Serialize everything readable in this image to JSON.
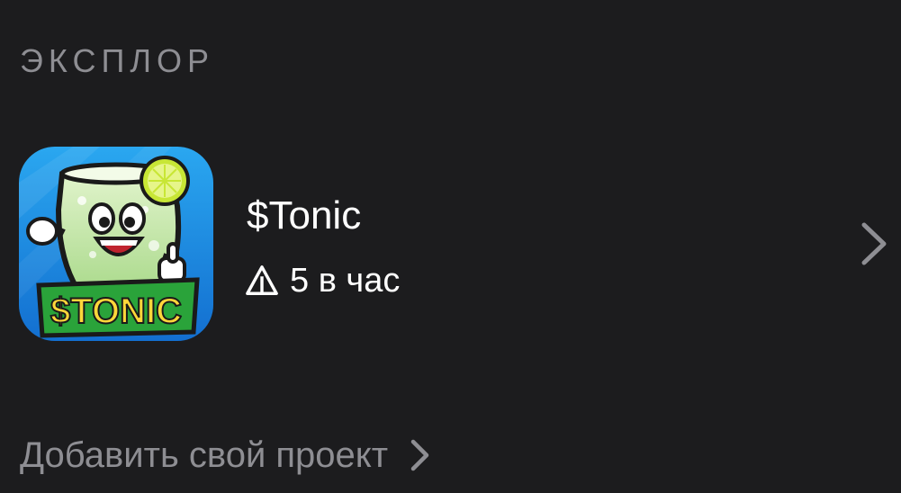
{
  "section": {
    "title": "ЭКСПЛОР"
  },
  "project": {
    "name": "$Tonic",
    "meta": "5 в час",
    "icon_logo_text": "$TONIC",
    "icon": "tonic-app-icon",
    "meta_icon": "warning-triangle-icon",
    "chevron_icon": "chevron-right-icon"
  },
  "add_project": {
    "label": "Добавить свой проект",
    "icon": "chevron-right-icon"
  },
  "colors": {
    "background": "#1c1c1e",
    "secondary_text": "#8e8e93",
    "primary_text": "#ffffff",
    "icon_blue": "#1f8fe0",
    "icon_green": "#2aa33a",
    "icon_lime": "#c8e635"
  }
}
